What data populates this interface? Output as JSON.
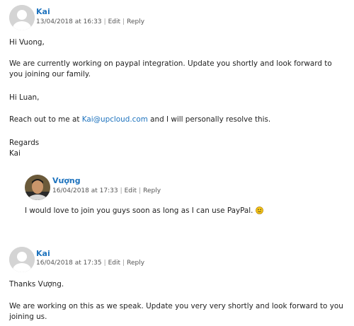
{
  "comment1": {
    "author": "Kai",
    "date": "13/04/2018 at 16:33",
    "edit": "Edit",
    "reply": "Reply",
    "separator": "|",
    "p1": "Hi Vuong,",
    "p2": "We are currently working on paypal integration. Update you shortly and look forward to you joining our family.",
    "p3": "Hi Luan,",
    "p4_before": "Reach out to me at ",
    "p4_email": "Kai@upcloud.com",
    "p4_after": " and I will personally resolve this.",
    "p5_line1": "Regards",
    "p5_line2": "Kai"
  },
  "reply1": {
    "author": "Vượng",
    "date": "16/04/2018 at 17:33",
    "edit": "Edit",
    "reply": "Reply",
    "separator": "|",
    "text": "I would love to join you guys soon as long as I can use PayPal.",
    "emoji_icon": "smiley-icon"
  },
  "comment2": {
    "author": "Kai",
    "date": "16/04/2018 at 17:35",
    "edit": "Edit",
    "reply": "Reply",
    "separator": "|",
    "p1": "Thanks Vượng.",
    "p2": "We are working on this as we speak. Update you very very shortly and look forward to you joining us."
  },
  "colors": {
    "link": "#1e73be",
    "text": "#222222",
    "meta": "#555555",
    "avatar_bg": "#d4d4d4"
  }
}
